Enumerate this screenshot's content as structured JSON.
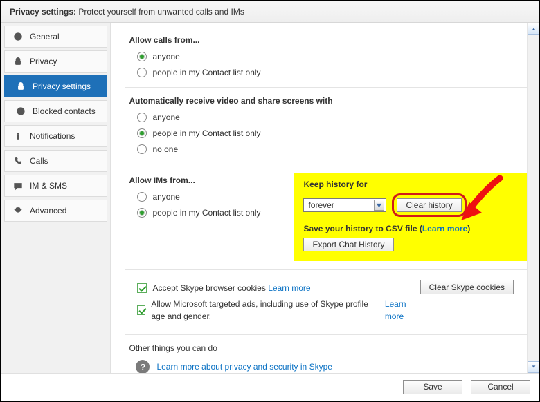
{
  "header": {
    "title_bold": "Privacy settings:",
    "title_rest": " Protect yourself from unwanted calls and IMs"
  },
  "sidebar": {
    "items": [
      {
        "label": "General"
      },
      {
        "label": "Privacy"
      },
      {
        "label": "Privacy settings"
      },
      {
        "label": "Blocked contacts"
      },
      {
        "label": "Notifications"
      },
      {
        "label": "Calls"
      },
      {
        "label": "IM & SMS"
      },
      {
        "label": "Advanced"
      }
    ]
  },
  "sections": {
    "calls_title": "Allow calls from...",
    "calls_options": {
      "opt0": "anyone",
      "opt1": "people in my Contact list only"
    },
    "video_title": "Automatically receive video and share screens with",
    "video_options": {
      "opt0": "anyone",
      "opt1": "people in my Contact list only",
      "opt2": "no one"
    },
    "ims_title": "Allow IMs from...",
    "ims_options": {
      "opt0": "anyone",
      "opt1": "people in my Contact list only"
    }
  },
  "history": {
    "title": "Keep history for",
    "select_value": "forever",
    "clear_label": "Clear history",
    "save_label_a": "Save your history to CSV file (",
    "save_link": "Learn more",
    "save_label_b": ")",
    "export_label": "Export Chat History"
  },
  "cookies": {
    "accept_label": "Accept Skype browser cookies",
    "accept_link": "Learn more",
    "ads_label": "Allow Microsoft targeted ads, including use of Skype profile age and gender.",
    "ads_link": "Learn more",
    "clear_cookies_label": "Clear Skype cookies"
  },
  "other": {
    "title": "Other things you can do",
    "link": "Learn more about privacy and security in Skype"
  },
  "footer": {
    "save": "Save",
    "cancel": "Cancel"
  }
}
